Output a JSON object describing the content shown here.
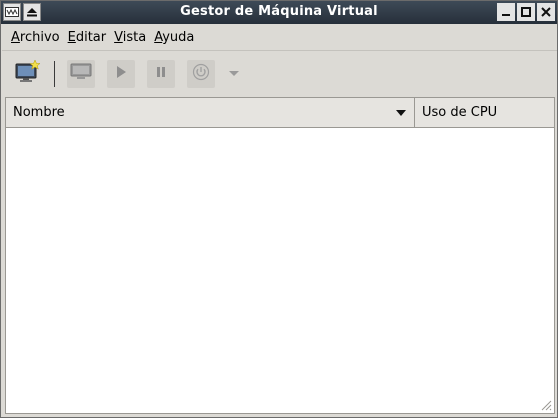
{
  "window": {
    "title": "Gestor de Máquina Virtual"
  },
  "titlebar_buttons": {
    "left": [
      "window-menu-icon",
      "shade-icon"
    ],
    "right": [
      "minimize-icon",
      "maximize-icon",
      "close-icon"
    ]
  },
  "menubar": {
    "items": [
      {
        "label": "Archivo",
        "mnemonic": "A",
        "rest": "rchivo"
      },
      {
        "label": "Editar",
        "mnemonic": "E",
        "rest": "ditar"
      },
      {
        "label": "Vista",
        "mnemonic": "V",
        "rest": "ista"
      },
      {
        "label": "Ayuda",
        "mnemonic": "A",
        "rest": "yuda"
      }
    ]
  },
  "toolbar": {
    "buttons": [
      {
        "name": "new-vm-icon",
        "enabled": true
      },
      {
        "name": "open-console-icon",
        "enabled": false
      },
      {
        "name": "run-icon",
        "enabled": false
      },
      {
        "name": "pause-icon",
        "enabled": false
      },
      {
        "name": "shutdown-icon",
        "enabled": false
      }
    ]
  },
  "list": {
    "columns": [
      {
        "label": "Nombre"
      },
      {
        "label": "Uso de CPU"
      }
    ],
    "rows": []
  }
}
